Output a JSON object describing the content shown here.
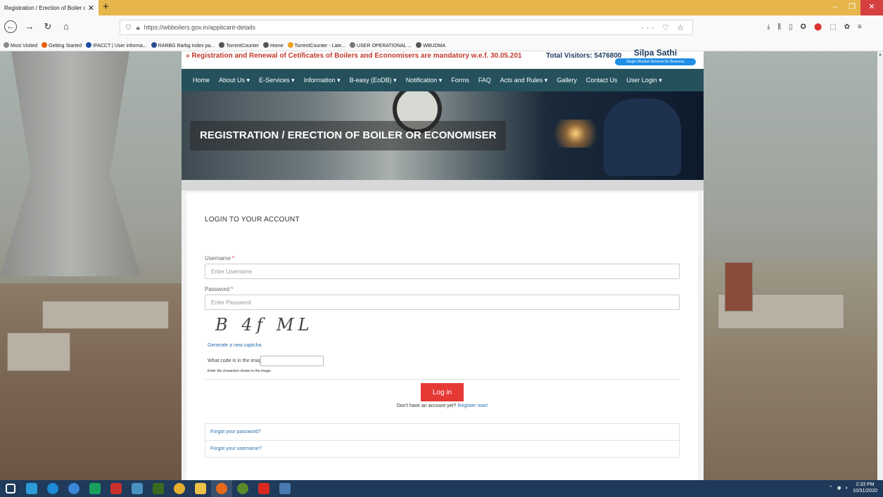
{
  "browser": {
    "tab_title": "Registration / Erection of Boiler or E",
    "url": "https://wbboilers.gov.in/applicant-details",
    "url_actions": "··· ♡ ☆",
    "bookmarks": [
      {
        "label": "Most Visited",
        "color": "#888888"
      },
      {
        "label": "Getting Started",
        "color": "#e66000"
      },
      {
        "label": "IPACCT | User informa...",
        "color": "#1e4fa0"
      },
      {
        "label": "RARBG Rarbg Index pa...",
        "color": "#2a4f8f"
      },
      {
        "label": "TorrentCounter",
        "color": "#555555"
      },
      {
        "label": "Home",
        "color": "#555555"
      },
      {
        "label": "TorrentCounter - Late...",
        "color": "#f0a020"
      },
      {
        "label": "USER OPERATIONAL ...",
        "color": "#777777"
      },
      {
        "label": "WBUDMA",
        "color": "#555555"
      }
    ]
  },
  "site": {
    "marquee": "» Registration and Renewal of Cetificates of Boilers and Economisers are mandatory w.e.f. 30.05.201",
    "visitors": "Total Visitors: 5476800",
    "silpa_name": "Silpa Sathi",
    "silpa_tagline": "Single Window Services for Business",
    "nav": [
      "Home",
      "About Us ▾",
      "E-Services ▾",
      "Information ▾",
      "B-easy (EoDB) ▾",
      "Notification ▾",
      "Forms",
      "FAQ",
      "Acts and Rules ▾",
      "Gallery",
      "Contact Us",
      "User Login ▾"
    ],
    "banner_title": "REGISTRATION / ERECTION OF BOILER OR ECONOMISER"
  },
  "login": {
    "title": "LOGIN TO YOUR ACCOUNT",
    "username_label": "Username",
    "username_placeholder": "Enter Username",
    "password_label": "Password",
    "password_placeholder": "Enter Password",
    "required_mark": "*",
    "captcha_text": "B 4f ML",
    "new_captcha": "Generate a new captcha",
    "captcha_question": "What code is in the image?",
    "captcha_hint": "Enter the characters shown in the image.",
    "login_button": "Log in",
    "no_account": "Don't have an account yet?",
    "register_link": "Register now!",
    "forgot_password": "Forgot your password?",
    "forgot_username": "Forgot your username?"
  },
  "tray": {
    "time": "2:33 PM",
    "date": "10/31/2020"
  },
  "taskbar_apps": [
    {
      "name": "windows-start",
      "color": "#ffffff"
    },
    {
      "name": "internet-explorer",
      "color": "#2e9bd9"
    },
    {
      "name": "edge",
      "color": "#1c8ad4"
    },
    {
      "name": "chrome-alt",
      "color": "#3b86d8"
    },
    {
      "name": "store",
      "color": "#17a05d"
    },
    {
      "name": "filezilla",
      "color": "#c9302c"
    },
    {
      "name": "network",
      "color": "#4a90c0"
    },
    {
      "name": "dreamweaver",
      "color": "#3a6a1f"
    },
    {
      "name": "chrome",
      "color": "#e8b030"
    },
    {
      "name": "file-explorer",
      "color": "#f0c24a"
    },
    {
      "name": "firefox",
      "color": "#e66a1a"
    },
    {
      "name": "app-circle",
      "color": "#5a8a2a"
    },
    {
      "name": "acrobat",
      "color": "#d8281f"
    },
    {
      "name": "word-ish",
      "color": "#4a7ab0"
    }
  ],
  "colors": {
    "site_nav": "#24515c",
    "login_button": "#e53935",
    "link": "#2a6fb0",
    "tab_strip": "#e6b64c"
  }
}
